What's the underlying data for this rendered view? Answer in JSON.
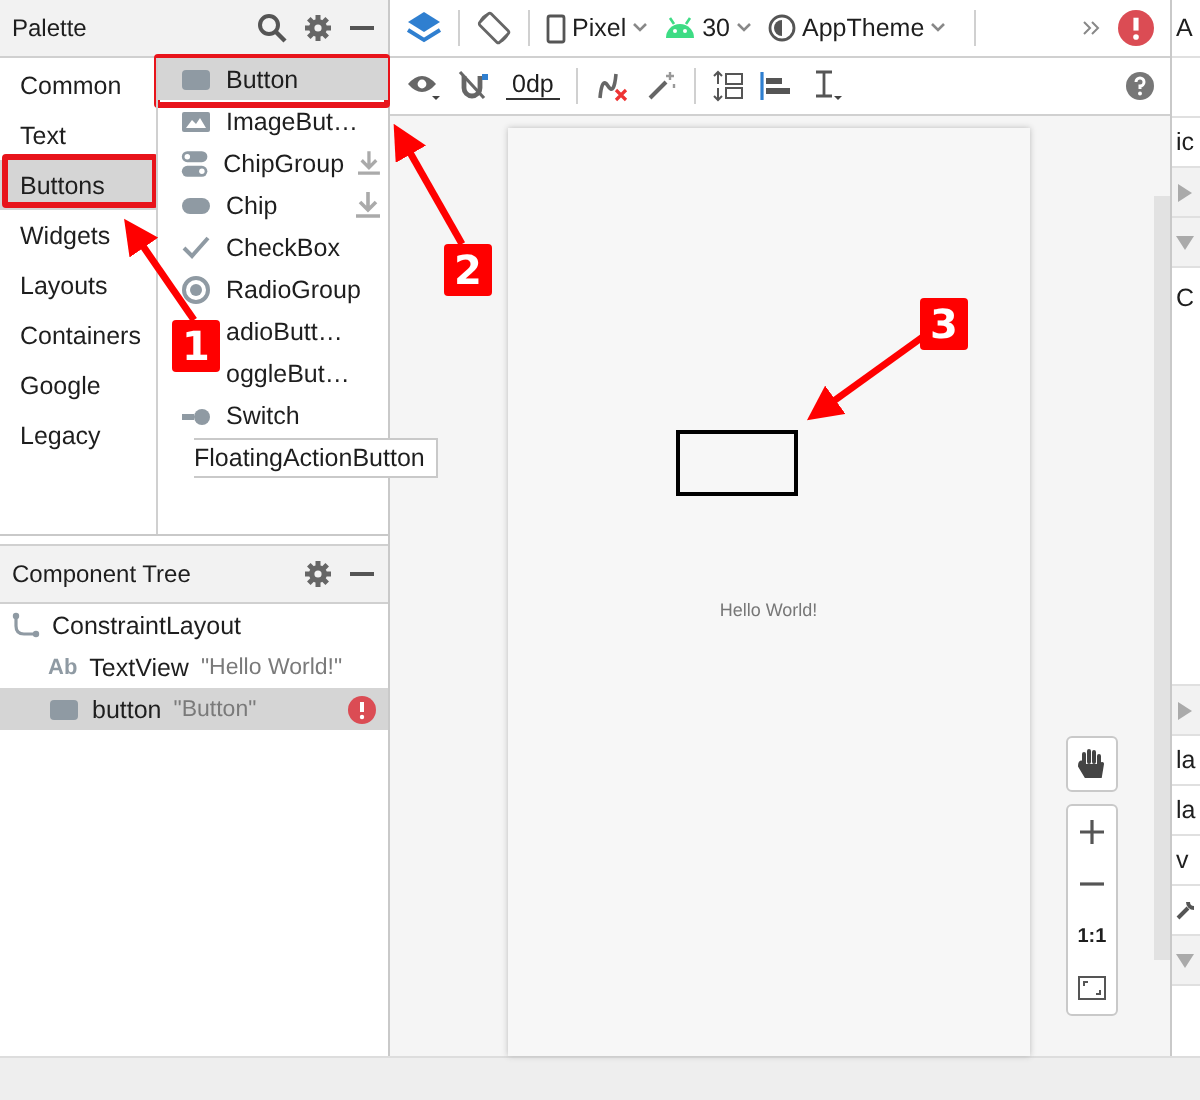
{
  "palette": {
    "title": "Palette",
    "categories": [
      {
        "label": "Common",
        "selected": false
      },
      {
        "label": "Text",
        "selected": false
      },
      {
        "label": "Buttons",
        "selected": true
      },
      {
        "label": "Widgets",
        "selected": false
      },
      {
        "label": "Layouts",
        "selected": false
      },
      {
        "label": "Containers",
        "selected": false
      },
      {
        "label": "Google",
        "selected": false
      },
      {
        "label": "Legacy",
        "selected": false
      }
    ],
    "items": [
      {
        "label": "Button",
        "kind": "button",
        "selected": true,
        "download": false
      },
      {
        "label": "ImageBut…",
        "kind": "image",
        "selected": false,
        "download": false
      },
      {
        "label": "ChipGroup",
        "kind": "chipgroup",
        "selected": false,
        "download": true
      },
      {
        "label": "Chip",
        "kind": "chip",
        "selected": false,
        "download": true
      },
      {
        "label": "CheckBox",
        "kind": "check",
        "selected": false,
        "download": false
      },
      {
        "label": "RadioGroup",
        "kind": "radiogroup",
        "selected": false,
        "download": false
      },
      {
        "label": "adioButt…",
        "kind": "radio",
        "selected": false,
        "download": false
      },
      {
        "label": "oggleBut…",
        "kind": "toggle",
        "selected": false,
        "download": false
      },
      {
        "label": "Switch",
        "kind": "switch",
        "selected": false,
        "download": false
      },
      {
        "label": "FloatingActionButton",
        "kind": "fab",
        "selected": false,
        "download": false
      }
    ]
  },
  "component_tree": {
    "title": "Component Tree",
    "nodes": [
      {
        "label": "ConstraintLayout",
        "kind": "layout",
        "selected": false,
        "error": false,
        "children": [
          {
            "label": "TextView",
            "kind": "text",
            "icon_text": "Ab",
            "detail": "\"Hello World!\"",
            "selected": false,
            "error": false
          },
          {
            "label": "button",
            "kind": "button",
            "detail": "\"Button\"",
            "selected": true,
            "error": true
          }
        ]
      }
    ]
  },
  "toolbar": {
    "device": "Pixel",
    "api": "30",
    "theme": "AppTheme",
    "margin": "0dp"
  },
  "canvas": {
    "text": "Hello World!",
    "zoom_reset": "1:1"
  },
  "attributes_panel": {
    "title": "A",
    "rows": [
      {
        "kind": "text",
        "label": "ic"
      },
      {
        "kind": "collapsed"
      },
      {
        "kind": "expanded"
      },
      {
        "kind": "text",
        "label": "C"
      },
      {
        "kind": "collapsed"
      },
      {
        "kind": "text",
        "label": "la"
      },
      {
        "kind": "text",
        "label": "la"
      },
      {
        "kind": "text",
        "label": "v"
      },
      {
        "kind": "tool"
      },
      {
        "kind": "expanded"
      }
    ]
  },
  "annotations": [
    {
      "number": "1"
    },
    {
      "number": "2"
    },
    {
      "number": "3"
    }
  ]
}
